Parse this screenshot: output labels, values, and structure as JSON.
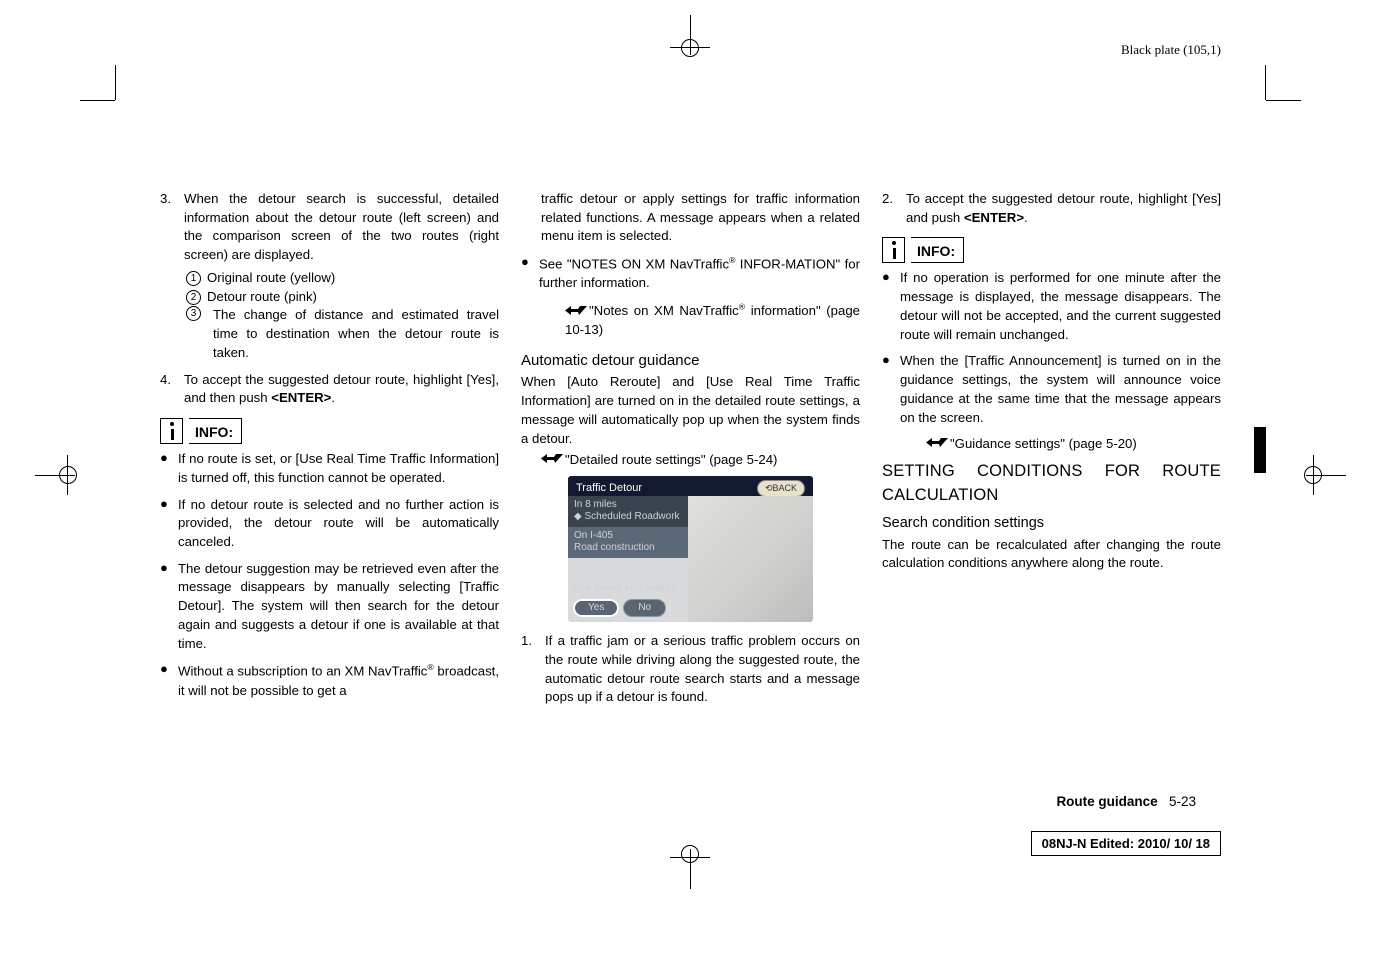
{
  "blackplate": "Black plate (105,1)",
  "col1": {
    "item3": {
      "n": "3.",
      "text": "When the detour search is successful, detailed information about the detour route (left screen) and the comparison screen of the two routes (right screen) are displayed."
    },
    "c1": {
      "n": "1",
      "text": "Original route (yellow)"
    },
    "c2": {
      "n": "2",
      "text": "Detour route (pink)"
    },
    "c3": {
      "n": "3",
      "text": "The change of distance and estimated travel time to destination when the detour route is taken."
    },
    "item4": {
      "n": "4.",
      "text": "To accept the suggested detour route, highlight [Yes], and then push <ENTER>."
    },
    "info": "INFO:",
    "b1": "If no route is set, or [Use Real Time Traffic Information] is turned off, this function cannot be operated.",
    "b2": "If no detour route is selected and no further action is provided, the detour route will be automatically canceled.",
    "b3": "The detour suggestion may be retrieved even after the message disappears by manually selecting [Traffic Detour]. The system will then search for the detour again and suggests a detour if one is available at that time.",
    "b4a": "Without a subscription to an XM NavTraffic",
    "b4b": " broadcast, it will not be possible to get a"
  },
  "col2": {
    "cont": "traffic detour or apply settings for traffic information related functions. A message appears when a related menu item is selected.",
    "b1a": "See \"NOTES ON XM NavTraffic",
    "b1b": " INFOR-MATION\" for further information.",
    "ref1a": "\"Notes on XM NavTraffic",
    "ref1b": " information\" (page 10-13)",
    "h2": "Automatic detour guidance",
    "p1": "When [Auto Reroute] and [Use Real Time Traffic Information] are turned on in the detailed route settings, a message will automatically pop up when the system finds a detour.",
    "ref2": "\"Detailed route settings\" (page 5-24)",
    "ss": {
      "title": "Traffic Detour",
      "back": "BACK",
      "l1": "In 8 miles",
      "l2": "Scheduled Roadwork",
      "l3": "On I-405",
      "l4": "Road construction",
      "q": "Use detour in: 7 miles?",
      "yes": "Yes",
      "no": "No"
    },
    "item1": {
      "n": "1.",
      "text": "If a traffic jam or a serious traffic problem occurs on the route while driving along the suggested route, the automatic detour route search starts and a message pops up if a detour is found."
    }
  },
  "col3": {
    "item2": {
      "n": "2.",
      "text": "To accept the suggested detour route, highlight [Yes] and push <ENTER>."
    },
    "info": "INFO:",
    "b1": "If no operation is performed for one minute after the message is displayed, the message disappears. The detour will not be accepted, and the current suggested route will remain unchanged.",
    "b2": "When the [Traffic Announcement] is turned on in the guidance settings, the system will announce voice guidance at the same time that the message appears on the screen.",
    "ref1": "\"Guidance settings\" (page 5-20)",
    "h1": "SETTING CONDITIONS FOR ROUTE CALCULATION",
    "h3": "Search condition settings",
    "p1": "The route can be recalculated after changing the route calculation conditions anywhere along the route."
  },
  "footer": {
    "label": "Route guidance",
    "page": "5-23"
  },
  "editbox": "08NJ-N Edited:  2010/ 10/ 18"
}
